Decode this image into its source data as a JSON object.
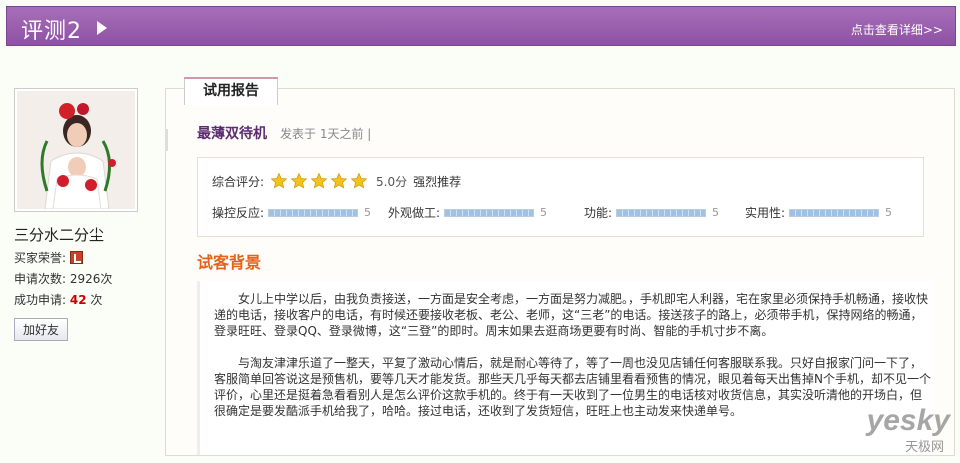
{
  "header": {
    "title": "评测2",
    "more_link": "点击查看详细>>"
  },
  "user": {
    "name": "三分水二分尘",
    "honor_label": "买家荣誉:",
    "apply_count_label": "申请次数:",
    "apply_count_value": "2926次",
    "success_label": "成功申请:",
    "success_value": "42",
    "success_unit": "次",
    "add_friend": "加好友"
  },
  "report": {
    "tab_label": "试用报告",
    "product_name": "最薄双待机",
    "posted_text": "发表于 1天之前  |",
    "overall_label": "综合评分:",
    "overall_stars": 5,
    "overall_score": "5.0分",
    "recommend": "强烈推荐",
    "metrics": [
      {
        "label": "操控反应:",
        "value": "5"
      },
      {
        "label": "外观做工:",
        "value": "5"
      },
      {
        "label": "功能:",
        "value": "5"
      },
      {
        "label": "实用性:",
        "value": "5"
      }
    ],
    "background_title": "试客背景",
    "paragraphs": [
      "女儿上中学以后，由我负责接送，一方面是安全考虑，一方面是努力减肥。，手机即宅人利器，宅在家里必须保持手机畅通，接收快递的电话，接收客户的电话，有时候还要接收老板、老公、老师，这“三老”的电话。接送孩子的路上，必须带手机，保持网络的畅通，登录旺旺、登录QQ、登录微博，这“三登”的即时。周末如果去逛商场更要有时尚、智能的手机寸步不离。",
      "与淘友津津乐道了一整天，平复了激动心情后，就是耐心等待了，等了一周也没见店铺任何客服联系我。只好自报家门问一下了，客服简单回答说这是预售机，要等几天才能发货。那些天几乎每天都去店铺里看看预售的情况，眼见着每天出售掉N个手机，却不见一个评价，心里还是挺着急看看别人是怎么评价这款手机的。终于有一天收到了一位男生的电话核对收货信息，其实没听清他的开场白，但很确定是要发酷派手机给我了，哈哈。接过电话，还收到了发货短信，旺旺上也主动发来快递单号。"
    ]
  },
  "watermark": {
    "brand_main": "yesky",
    "brand_cn": "天极网"
  },
  "colors": {
    "header": "#9a5cae",
    "accent_orange": "#e5621b",
    "product_purple": "#5b2c6f",
    "star": "#f4c21b"
  }
}
